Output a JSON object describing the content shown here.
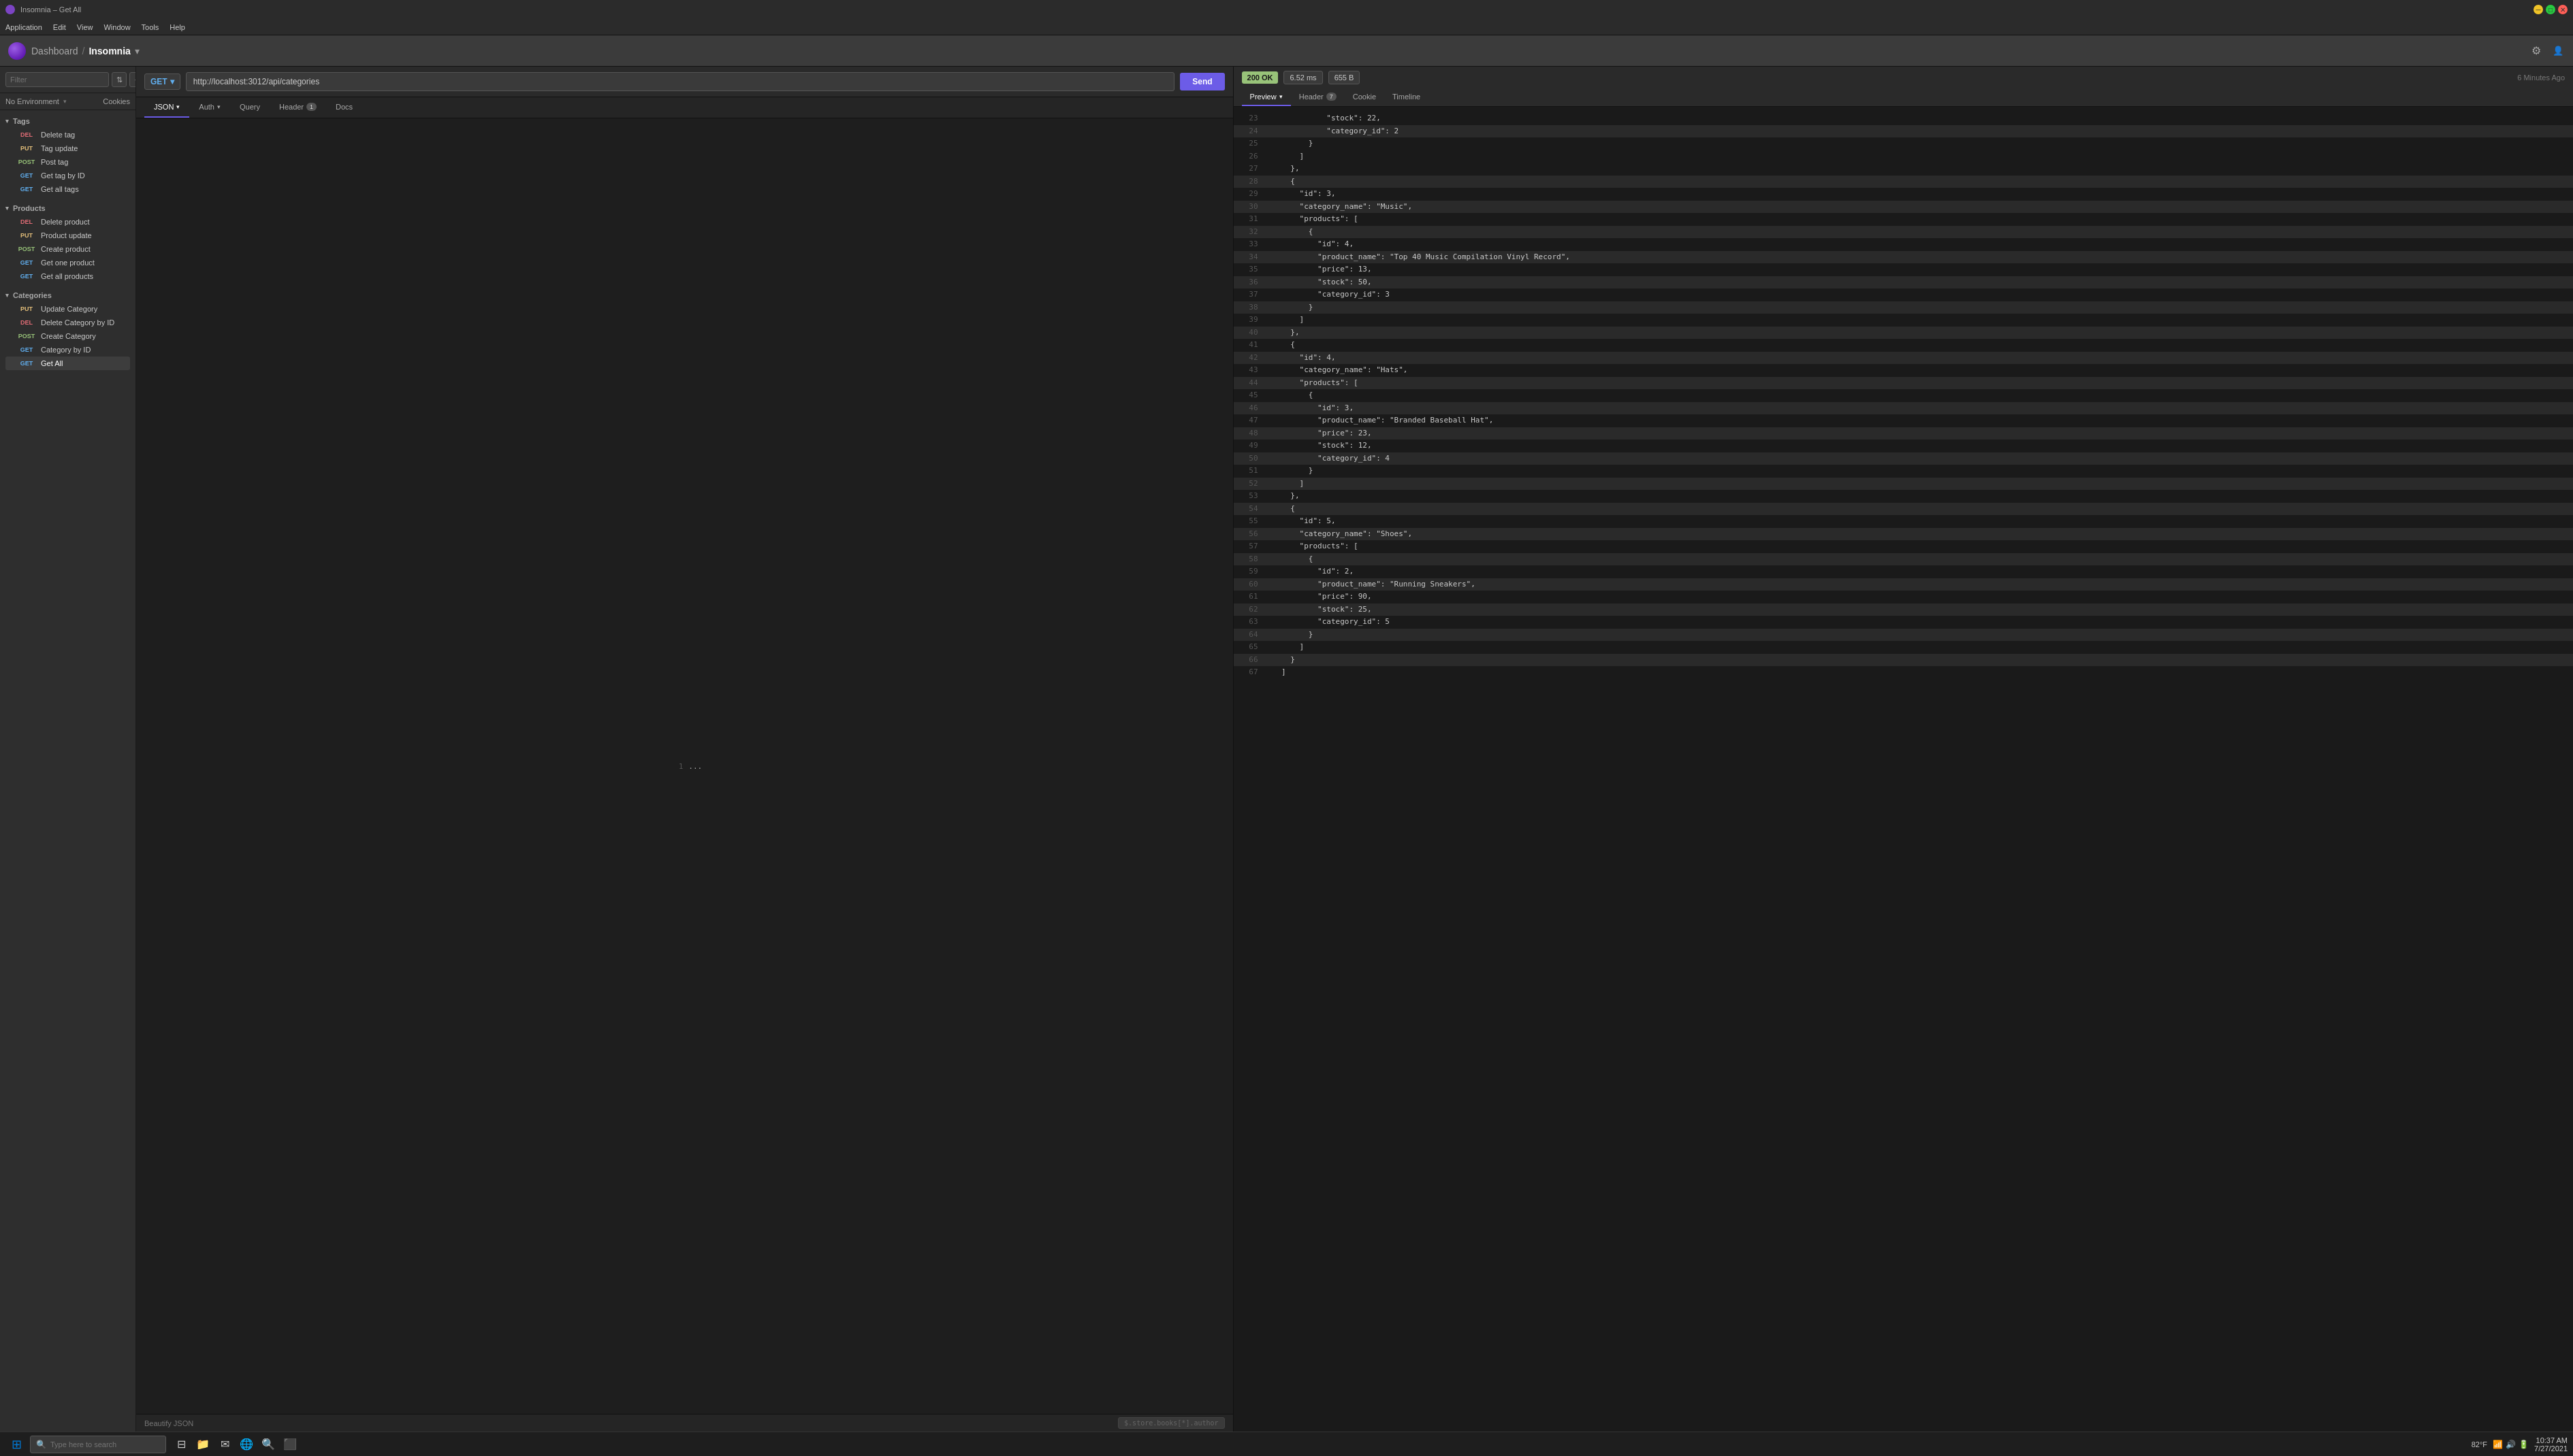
{
  "window": {
    "title": "Insomnia – Get All"
  },
  "menu": {
    "items": [
      "Application",
      "Edit",
      "View",
      "Window",
      "Tools",
      "Help"
    ]
  },
  "header": {
    "breadcrumb_root": "Dashboard",
    "breadcrumb_separator": "/",
    "breadcrumb_current": "Insomnia"
  },
  "no_environment_label": "No Environment",
  "cookies_label": "Cookies",
  "request": {
    "method": "GET",
    "url": "http://localhost:3012/api/categories",
    "send_label": "Send"
  },
  "request_tabs": [
    {
      "id": "json",
      "label": "JSON",
      "has_dropdown": true,
      "badge": null
    },
    {
      "id": "auth",
      "label": "Auth",
      "has_dropdown": true,
      "badge": null
    },
    {
      "id": "query",
      "label": "Query",
      "has_dropdown": false,
      "badge": null
    },
    {
      "id": "header",
      "label": "Header",
      "has_dropdown": false,
      "badge": "1"
    },
    {
      "id": "docs",
      "label": "Docs",
      "has_dropdown": false,
      "badge": null
    }
  ],
  "editor": {
    "line": "1",
    "content": "..."
  },
  "bottom_bar": {
    "beautify_label": "Beautify JSON",
    "formula": "$.store.books[*].author"
  },
  "response": {
    "status_code": "200",
    "status_text": "OK",
    "time": "6.52 ms",
    "size": "655 B",
    "time_ago": "6 Minutes Ago",
    "tabs": [
      {
        "id": "preview",
        "label": "Preview",
        "has_dropdown": true,
        "badge": null,
        "active": true
      },
      {
        "id": "header",
        "label": "Header",
        "badge": "7",
        "has_dropdown": false
      },
      {
        "id": "cookie",
        "label": "Cookie",
        "badge": null
      },
      {
        "id": "timeline",
        "label": "Timeline",
        "badge": null
      }
    ],
    "lines": [
      {
        "num": "23",
        "content": "              \"stock\": 22,",
        "highlight": false
      },
      {
        "num": "24",
        "content": "              \"category_id\": 2",
        "highlight": true
      },
      {
        "num": "25",
        "content": "          }",
        "highlight": false
      },
      {
        "num": "26",
        "content": "        ]",
        "highlight": false
      },
      {
        "num": "27",
        "content": "      },",
        "highlight": false
      },
      {
        "num": "28",
        "content": "      {",
        "highlight": true
      },
      {
        "num": "29",
        "content": "        \"id\": 3,",
        "highlight": false
      },
      {
        "num": "30",
        "content": "        \"category_name\": \"Music\",",
        "highlight": true
      },
      {
        "num": "31",
        "content": "        \"products\": [",
        "highlight": false
      },
      {
        "num": "32",
        "content": "          {",
        "highlight": true
      },
      {
        "num": "33",
        "content": "            \"id\": 4,",
        "highlight": false
      },
      {
        "num": "34",
        "content": "            \"product_name\": \"Top 40 Music Compilation Vinyl Record\",",
        "highlight": true
      },
      {
        "num": "35",
        "content": "            \"price\": 13,",
        "highlight": false
      },
      {
        "num": "36",
        "content": "            \"stock\": 50,",
        "highlight": true
      },
      {
        "num": "37",
        "content": "            \"category_id\": 3",
        "highlight": false
      },
      {
        "num": "38",
        "content": "          }",
        "highlight": true
      },
      {
        "num": "39",
        "content": "        ]",
        "highlight": false
      },
      {
        "num": "40",
        "content": "      },",
        "highlight": true
      },
      {
        "num": "41",
        "content": "      {",
        "highlight": false
      },
      {
        "num": "42",
        "content": "        \"id\": 4,",
        "highlight": true
      },
      {
        "num": "43",
        "content": "        \"category_name\": \"Hats\",",
        "highlight": false
      },
      {
        "num": "44",
        "content": "        \"products\": [",
        "highlight": true
      },
      {
        "num": "45",
        "content": "          {",
        "highlight": false
      },
      {
        "num": "46",
        "content": "            \"id\": 3,",
        "highlight": true
      },
      {
        "num": "47",
        "content": "            \"product_name\": \"Branded Baseball Hat\",",
        "highlight": false
      },
      {
        "num": "48",
        "content": "            \"price\": 23,",
        "highlight": true
      },
      {
        "num": "49",
        "content": "            \"stock\": 12,",
        "highlight": false
      },
      {
        "num": "50",
        "content": "            \"category_id\": 4",
        "highlight": true
      },
      {
        "num": "51",
        "content": "          }",
        "highlight": false
      },
      {
        "num": "52",
        "content": "        ]",
        "highlight": true
      },
      {
        "num": "53",
        "content": "      },",
        "highlight": false
      },
      {
        "num": "54",
        "content": "      {",
        "highlight": true
      },
      {
        "num": "55",
        "content": "        \"id\": 5,",
        "highlight": false
      },
      {
        "num": "56",
        "content": "        \"category_name\": \"Shoes\",",
        "highlight": true
      },
      {
        "num": "57",
        "content": "        \"products\": [",
        "highlight": false
      },
      {
        "num": "58",
        "content": "          {",
        "highlight": true
      },
      {
        "num": "59",
        "content": "            \"id\": 2,",
        "highlight": false
      },
      {
        "num": "60",
        "content": "            \"product_name\": \"Running Sneakers\",",
        "highlight": true
      },
      {
        "num": "61",
        "content": "            \"price\": 90,",
        "highlight": false
      },
      {
        "num": "62",
        "content": "            \"stock\": 25,",
        "highlight": true
      },
      {
        "num": "63",
        "content": "            \"category_id\": 5",
        "highlight": false
      },
      {
        "num": "64",
        "content": "          }",
        "highlight": true
      },
      {
        "num": "65",
        "content": "        ]",
        "highlight": false
      },
      {
        "num": "66",
        "content": "      }",
        "highlight": true
      },
      {
        "num": "67",
        "content": "    ]",
        "highlight": false
      }
    ]
  },
  "sidebar": {
    "filter_placeholder": "Filter",
    "sections": [
      {
        "id": "tags",
        "label": "Tags",
        "items": [
          {
            "method": "DEL",
            "label": "Delete tag"
          },
          {
            "method": "PUT",
            "label": "Tag update"
          },
          {
            "method": "POST",
            "label": "Post tag"
          },
          {
            "method": "GET",
            "label": "Get tag by ID"
          },
          {
            "method": "GET",
            "label": "Get all tags"
          }
        ]
      },
      {
        "id": "products",
        "label": "Products",
        "items": [
          {
            "method": "DEL",
            "label": "Delete product"
          },
          {
            "method": "PUT",
            "label": "Product update"
          },
          {
            "method": "POST",
            "label": "Create product"
          },
          {
            "method": "GET",
            "label": "Get one product"
          },
          {
            "method": "GET",
            "label": "Get all products"
          }
        ]
      },
      {
        "id": "categories",
        "label": "Categories",
        "items": [
          {
            "method": "PUT",
            "label": "Update Category"
          },
          {
            "method": "DEL",
            "label": "Delete Category by ID"
          },
          {
            "method": "POST",
            "label": "Create Category"
          },
          {
            "method": "GET",
            "label": "Category by ID"
          },
          {
            "method": "GET",
            "label": "Get All",
            "active": true
          }
        ]
      }
    ]
  },
  "taskbar": {
    "search_placeholder": "Type here to search",
    "time": "10:37 AM",
    "date": "7/27/2021",
    "weather": "82°F"
  }
}
